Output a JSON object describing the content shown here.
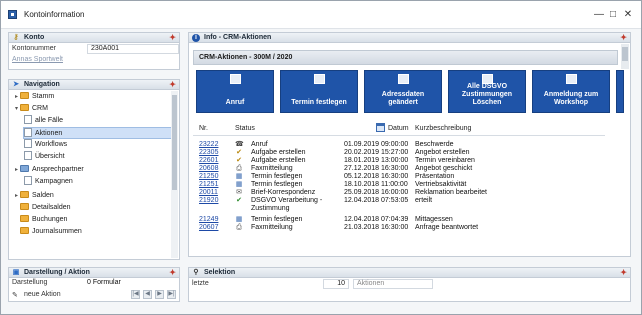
{
  "window": {
    "title": "Kontoinformation"
  },
  "konto": {
    "title": "Konto",
    "kontonummer_label": "Kontonummer",
    "kontonummer_value": "230A001",
    "name_link": "Annas Sportwelt"
  },
  "navigation": {
    "title": "Navigation",
    "items": [
      {
        "label": "Stamm"
      },
      {
        "label": "CRM"
      },
      {
        "label": "alle Fälle"
      },
      {
        "label": "Aktionen"
      },
      {
        "label": "Workflows"
      },
      {
        "label": "Übersicht"
      },
      {
        "label": "Ansprechpartner"
      },
      {
        "label": "Kampagnen"
      },
      {
        "label": "Salden"
      },
      {
        "label": "Detailsalden"
      },
      {
        "label": "Buchungen"
      },
      {
        "label": "Journalsummen"
      }
    ]
  },
  "darstellung": {
    "title": "Darstellung / Aktion",
    "darstellung_label": "Darstellung",
    "darstellung_value": "0 Formular",
    "new_action_label": "neue Aktion"
  },
  "info": {
    "title": "Info - CRM-Aktionen",
    "header": "CRM-Aktionen - 300M / 2020",
    "buttons": [
      {
        "label": "Anruf"
      },
      {
        "label": "Termin festlegen"
      },
      {
        "label": "Adressdaten geändert"
      },
      {
        "label": "Alle DSGVO Zustimmungen Löschen"
      },
      {
        "label": "Anmeldung zum Workshop"
      }
    ],
    "columns": {
      "nr": "Nr.",
      "status": "Status",
      "datum": "Datum",
      "beschreibung": "Kurzbeschreibung"
    },
    "rows": [
      {
        "nr": "23222",
        "status": "Anruf",
        "datum": "01.09.2019 09:00:00",
        "beschreibung": "Beschwerde",
        "icon": "phone-icon"
      },
      {
        "nr": "22305",
        "status": "Aufgabe erstellen",
        "datum": "20.02.2019 15:27:00",
        "beschreibung": "Angebot erstellen",
        "icon": "task-icon"
      },
      {
        "nr": "22601",
        "status": "Aufgabe erstellen",
        "datum": "18.01.2019 13:00:00",
        "beschreibung": "Termin vereinbaren",
        "icon": "task-icon"
      },
      {
        "nr": "20608",
        "status": "Faxmitteilung",
        "datum": "27.12.2018 16:30:00",
        "beschreibung": "Angebot geschickt",
        "icon": "fax-icon"
      },
      {
        "nr": "21250",
        "status": "Termin festlegen",
        "datum": "05.12.2018 16:30:00",
        "beschreibung": "Präsentation",
        "icon": "calendar-icon"
      },
      {
        "nr": "21251",
        "status": "Termin festlegen",
        "datum": "18.10.2018 11:00:00",
        "beschreibung": "Vertriebsaktivität",
        "icon": "calendar-icon"
      },
      {
        "nr": "20011",
        "status": "Brief-Korrespondenz",
        "datum": "25.09.2018 16:00:00",
        "beschreibung": "Reklamation bearbeitet",
        "icon": "letter-icon"
      },
      {
        "nr": "21920",
        "status": "DSGVO Verarbeitung -",
        "datum": "12.04.2018 07:53:05",
        "beschreibung": "erteilt",
        "icon": "check-icon"
      },
      {
        "nr": "",
        "status": "Zustimmung",
        "datum": "",
        "beschreibung": "",
        "icon": ""
      },
      {
        "nr": "21249",
        "status": "Termin festlegen",
        "datum": "12.04.2018 07:04:39",
        "beschreibung": "Mittagessen",
        "icon": "calendar-icon"
      },
      {
        "nr": "20607",
        "status": "Faxmitteilung",
        "datum": "21.03.2018 16:30:00",
        "beschreibung": "Anfrage beantwortet",
        "icon": "fax-icon"
      }
    ]
  },
  "selektion": {
    "title": "Selektion",
    "letzte_label": "letzte",
    "letzte_value": "10",
    "aktionen_label": "Aktionen"
  },
  "colors": {
    "accent": "#1f54a8",
    "link": "#1d49a6",
    "selected": "#cfe0f7"
  }
}
